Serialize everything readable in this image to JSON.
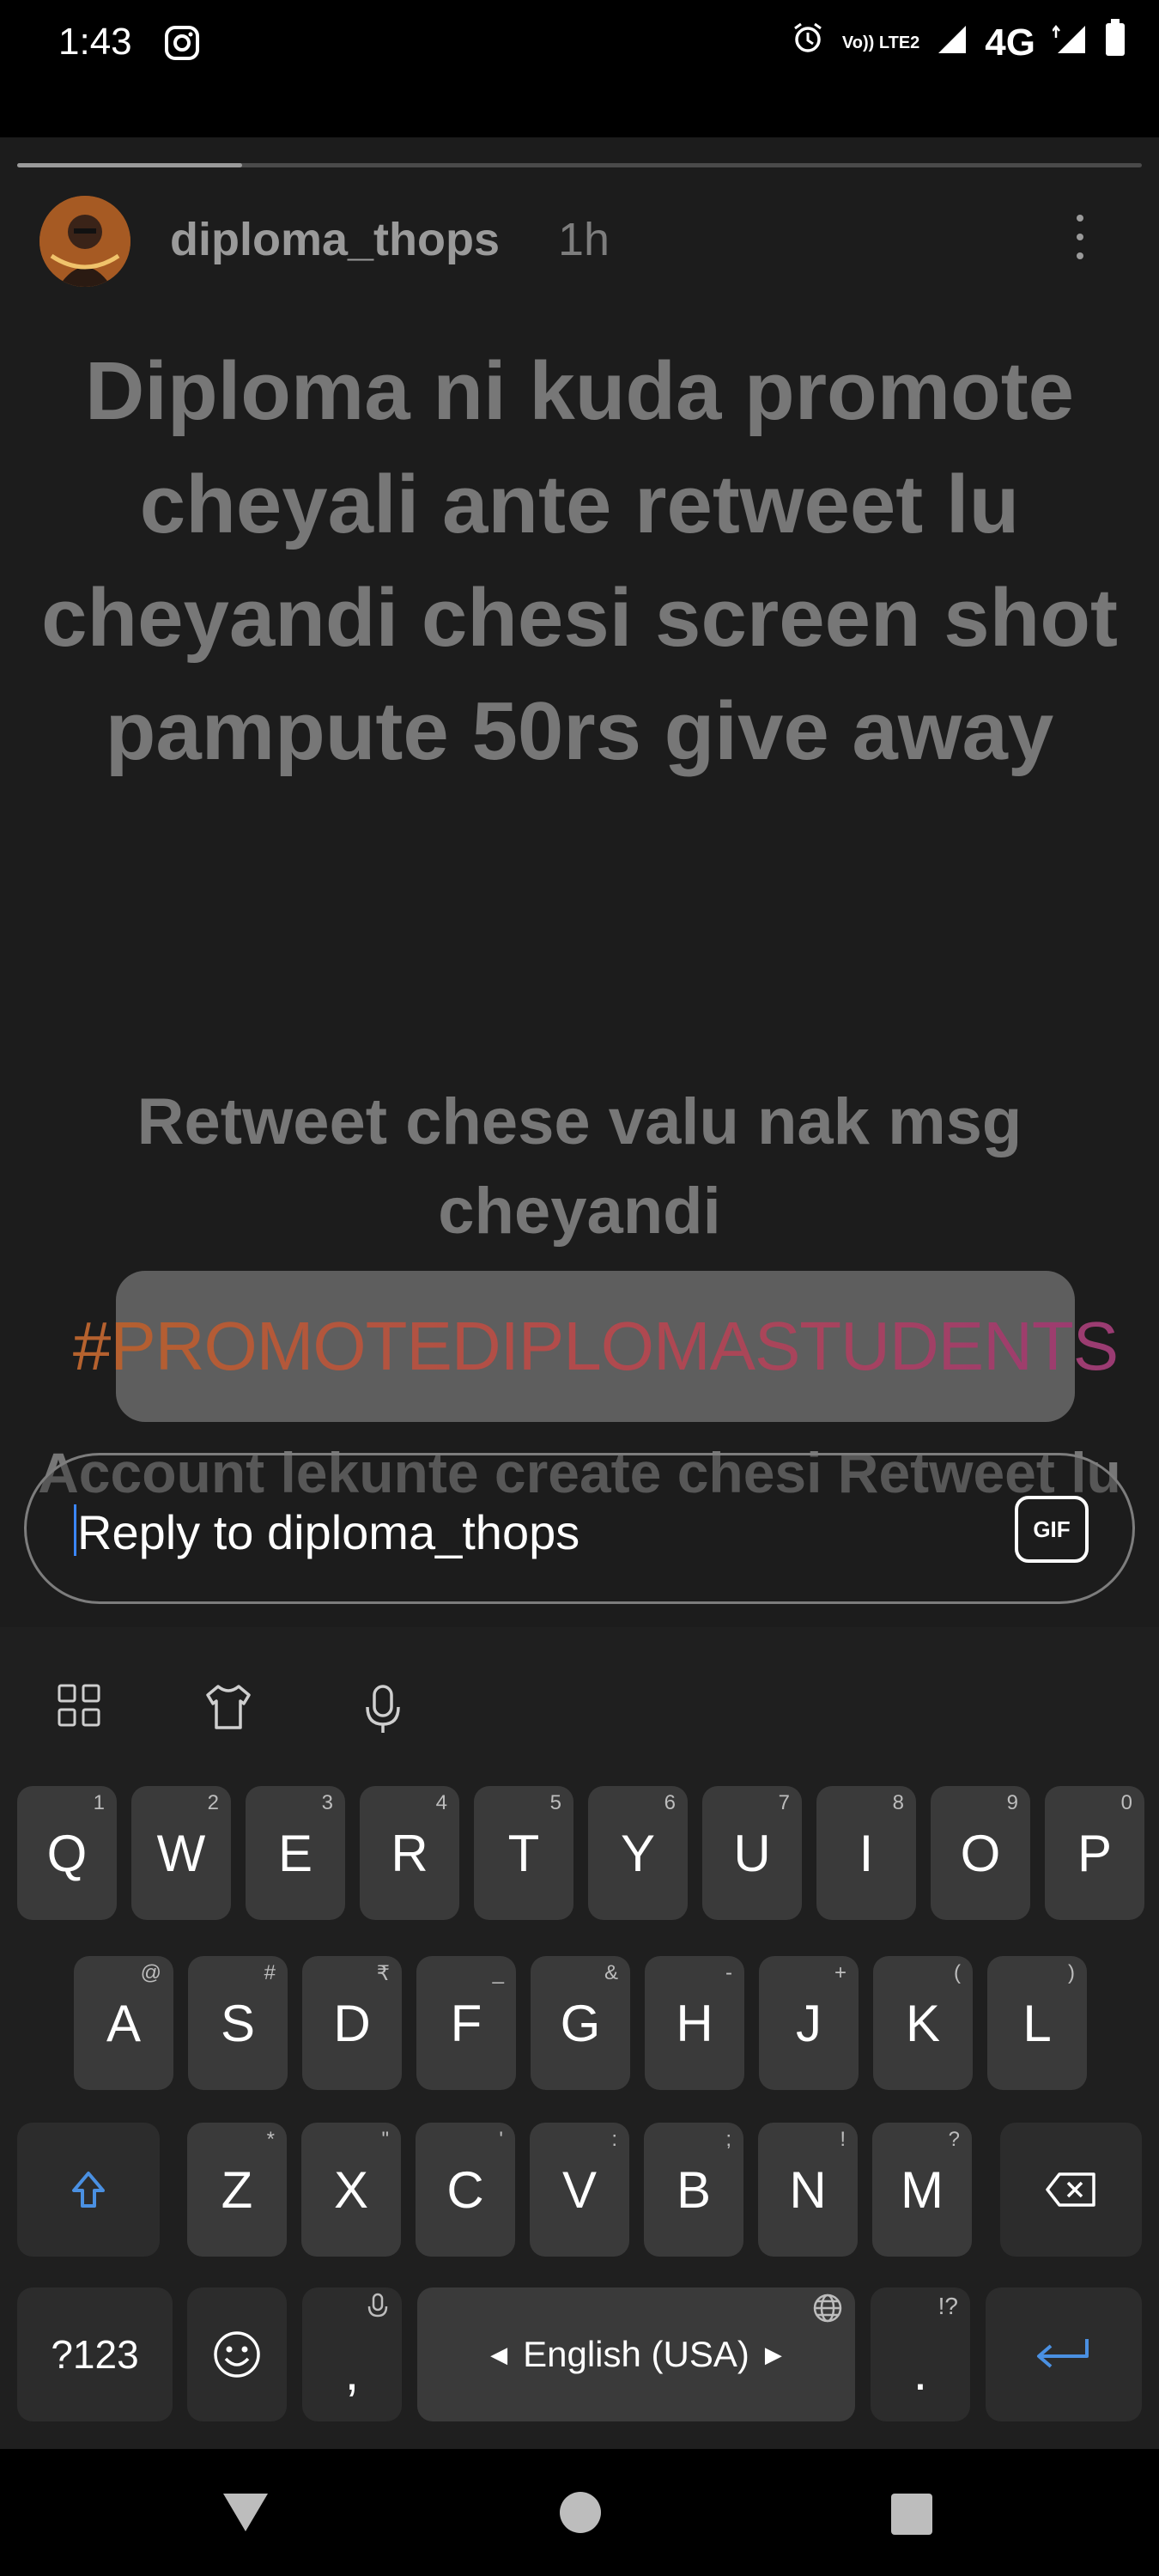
{
  "status_bar": {
    "time": "1:43",
    "network": "4G",
    "volte_label": "Vo)) LTE2",
    "icons": [
      "instagram-icon",
      "alarm-icon",
      "volte-icon",
      "signal-icon",
      "data-arrows-icon",
      "battery-icon"
    ]
  },
  "story": {
    "username": "diploma_thops",
    "time_ago": "1h",
    "progress": 0.2,
    "headline1": "Diploma ni kuda promote cheyali ante retweet lu cheyandi chesi screen shot pampute 50rs give away",
    "headline2": "Retweet chese valu nak msg cheyandi",
    "hashtag": "#PROMOTEDIPLOMASTUDENTS",
    "headline3": "Account lekunte create chesi Retweet lu",
    "hashtag_gradient": [
      "#b5622d",
      "#9a3b73"
    ]
  },
  "reply": {
    "placeholder": "Reply to diploma_thops",
    "gif_label": "GIF"
  },
  "keyboard": {
    "row1": [
      {
        "k": "Q",
        "h": "1"
      },
      {
        "k": "W",
        "h": "2"
      },
      {
        "k": "E",
        "h": "3"
      },
      {
        "k": "R",
        "h": "4"
      },
      {
        "k": "T",
        "h": "5"
      },
      {
        "k": "Y",
        "h": "6"
      },
      {
        "k": "U",
        "h": "7"
      },
      {
        "k": "I",
        "h": "8"
      },
      {
        "k": "O",
        "h": "9"
      },
      {
        "k": "P",
        "h": "0"
      }
    ],
    "row2": [
      {
        "k": "A",
        "h": "@"
      },
      {
        "k": "S",
        "h": "#"
      },
      {
        "k": "D",
        "h": "₹"
      },
      {
        "k": "F",
        "h": "_"
      },
      {
        "k": "G",
        "h": "&"
      },
      {
        "k": "H",
        "h": "-"
      },
      {
        "k": "J",
        "h": "+"
      },
      {
        "k": "K",
        "h": "("
      },
      {
        "k": "L",
        "h": ")"
      }
    ],
    "row3": [
      {
        "k": "Z",
        "h": "*"
      },
      {
        "k": "X",
        "h": "\""
      },
      {
        "k": "C",
        "h": "'"
      },
      {
        "k": "V",
        "h": ":"
      },
      {
        "k": "B",
        "h": ";"
      },
      {
        "k": "N",
        "h": "!"
      },
      {
        "k": "M",
        "h": "?"
      }
    ],
    "symbols_label": "?123",
    "comma": ",",
    "space_label": "English (USA)",
    "period": ".",
    "period_hint": "!?",
    "accent_color": "#4a90e2"
  }
}
